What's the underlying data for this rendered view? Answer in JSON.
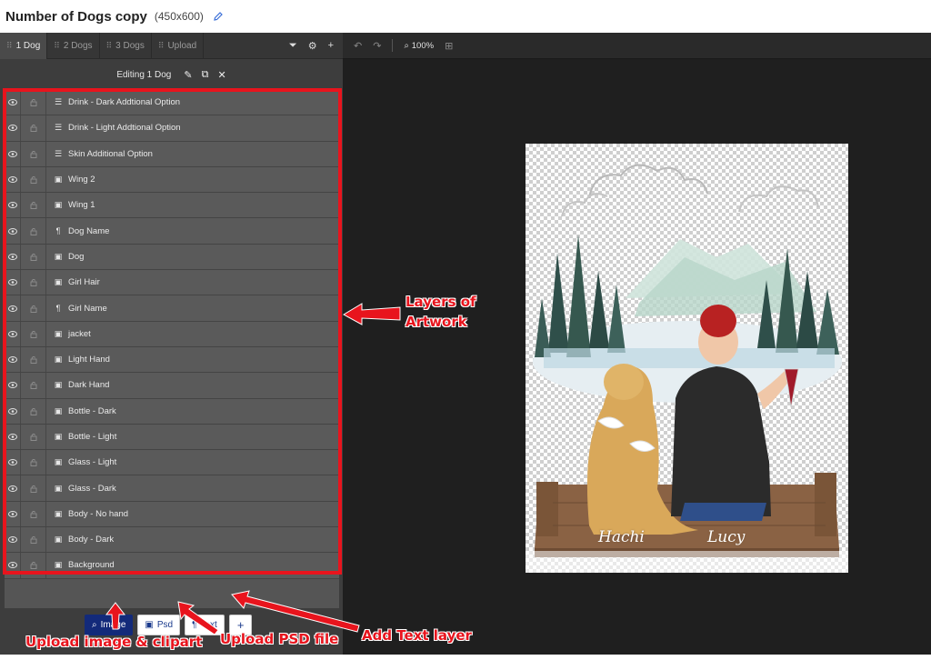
{
  "header": {
    "title": "Number of Dogs copy",
    "size": "(450x600)"
  },
  "tabs": [
    {
      "label": "1 Dog",
      "active": true
    },
    {
      "label": "2 Dogs",
      "active": false
    },
    {
      "label": "3 Dogs",
      "active": false
    },
    {
      "label": "Upload",
      "active": false
    }
  ],
  "editing": {
    "label": "Editing 1 Dog"
  },
  "layers": [
    {
      "name": "Drink - Dark Addtional Option",
      "type": "list"
    },
    {
      "name": "Drink - Light Addtional Option",
      "type": "list"
    },
    {
      "name": "Skin Additional Option",
      "type": "list"
    },
    {
      "name": "Wing 2",
      "type": "image"
    },
    {
      "name": "Wing 1",
      "type": "image"
    },
    {
      "name": "Dog Name",
      "type": "text"
    },
    {
      "name": "Dog",
      "type": "image"
    },
    {
      "name": "Girl Hair",
      "type": "image"
    },
    {
      "name": "Girl Name",
      "type": "text"
    },
    {
      "name": "jacket",
      "type": "image"
    },
    {
      "name": "Light Hand",
      "type": "image"
    },
    {
      "name": "Dark Hand",
      "type": "image"
    },
    {
      "name": "Bottle - Dark",
      "type": "image"
    },
    {
      "name": "Bottle - Light",
      "type": "image"
    },
    {
      "name": "Glass - Light",
      "type": "image"
    },
    {
      "name": "Glass - Dark",
      "type": "image"
    },
    {
      "name": "Body - No hand",
      "type": "image"
    },
    {
      "name": "Body - Dark",
      "type": "image"
    },
    {
      "name": "Background",
      "type": "image"
    }
  ],
  "actions": {
    "image": "Image",
    "psd": "Psd",
    "text": "Text",
    "plus": "+"
  },
  "toolbar": {
    "zoom": "100%"
  },
  "artwork": {
    "dog_name": "Hachi",
    "girl_name": "Lucy"
  },
  "annotations": {
    "layers_line1": "Layers of",
    "layers_line2": "Artwork",
    "upload_image": "Upload image & clipart",
    "upload_psd": "Upload PSD file",
    "add_text": "Add Text layer"
  },
  "colors": {
    "highlight": "#e8141d",
    "primary_button": "#132a7a"
  }
}
